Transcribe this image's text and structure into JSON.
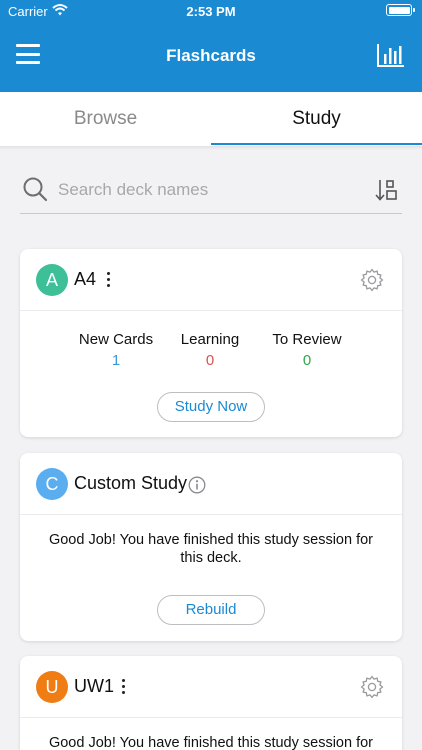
{
  "status_bar": {
    "carrier": "Carrier",
    "time": "2:53 PM"
  },
  "nav": {
    "title": "Flashcards"
  },
  "tabs": [
    {
      "label": "Browse",
      "active": false
    },
    {
      "label": "Study",
      "active": true
    }
  ],
  "search": {
    "placeholder": "Search deck names",
    "value": ""
  },
  "colors": {
    "brand_blue": "#1a8ad3",
    "avatar_teal": "#3dbf98",
    "avatar_blue": "#5aaef0",
    "avatar_orange": "#f07d14",
    "new_cards": "#3b9bd6",
    "learning": "#d9534f",
    "to_review": "#2ea84a"
  },
  "decks": [
    {
      "avatar_letter": "A",
      "name": "A4",
      "stats": [
        {
          "label": "New Cards",
          "value": "1"
        },
        {
          "label": "Learning",
          "value": "0"
        },
        {
          "label": "To Review",
          "value": "0"
        }
      ],
      "action_label": "Study Now"
    },
    {
      "avatar_letter": "C",
      "name": "Custom Study",
      "message": "Good Job! You have finished this study session for this deck.",
      "action_label": "Rebuild"
    },
    {
      "avatar_letter": "U",
      "name": "UW1",
      "message": "Good Job! You have finished this study session for"
    }
  ]
}
